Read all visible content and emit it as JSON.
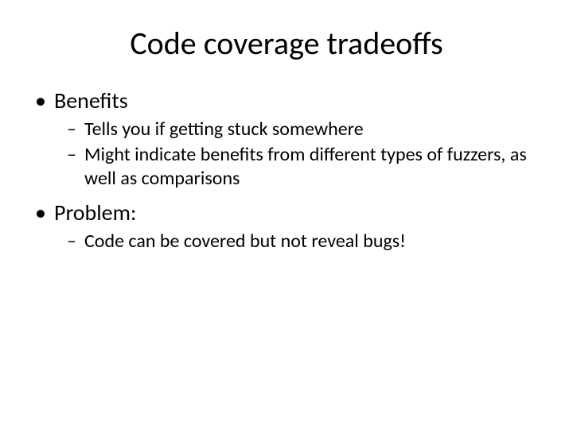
{
  "title": "Code coverage tradeoffs",
  "sections": [
    {
      "heading": "Benefits",
      "items": [
        "Tells you if getting stuck somewhere",
        "Might indicate benefits from different types of fuzzers, as well as comparisons"
      ]
    },
    {
      "heading": "Problem:",
      "items": [
        "Code can be covered but not reveal bugs!"
      ]
    }
  ]
}
